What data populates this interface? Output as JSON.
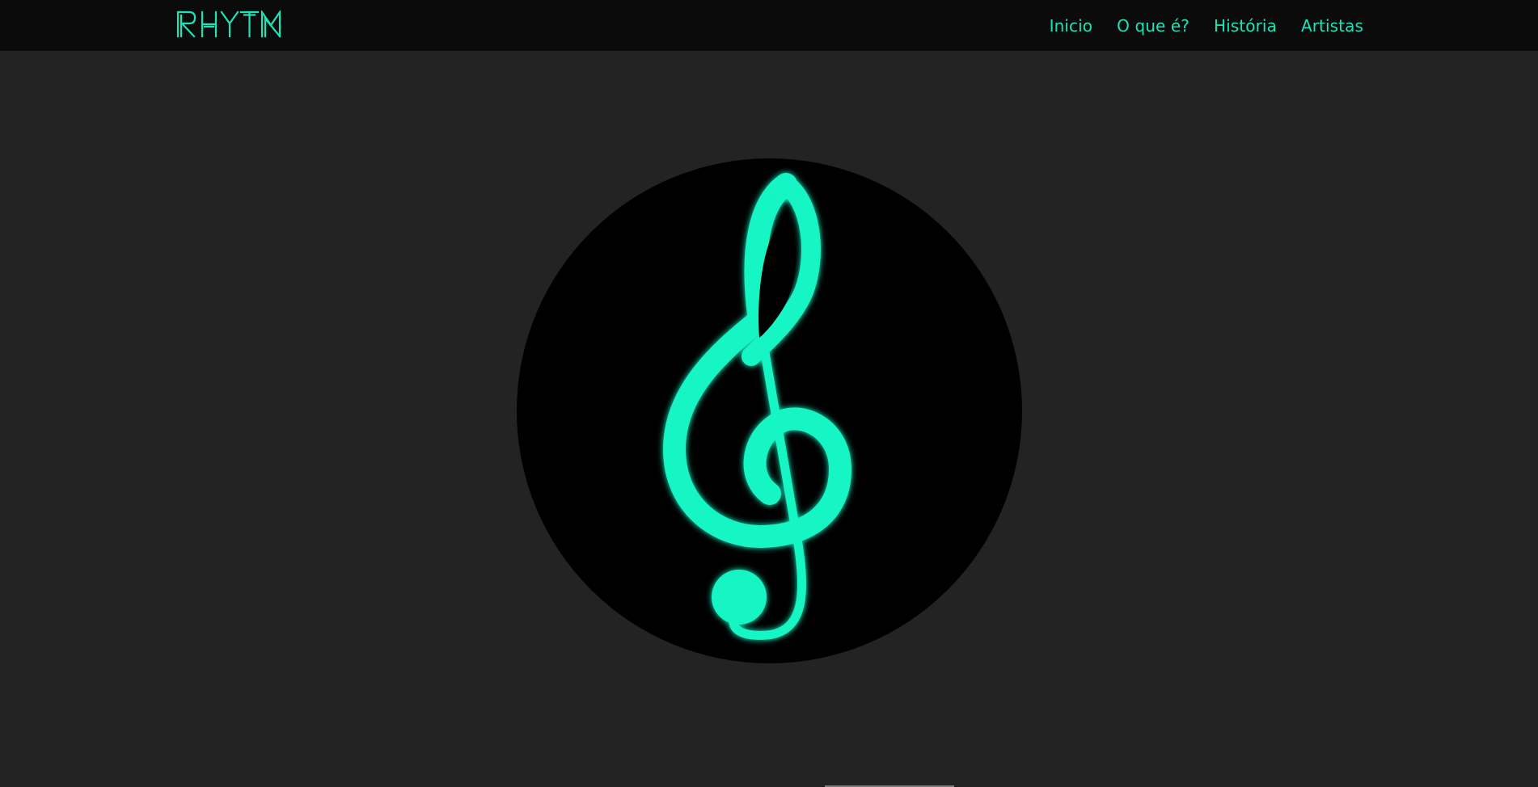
{
  "brand": {
    "name": "RHYTM",
    "accent_color": "#19e6b8"
  },
  "nav": {
    "items": [
      {
        "label": "Inicio"
      },
      {
        "label": "O que é?"
      },
      {
        "label": "História"
      },
      {
        "label": "Artistas"
      }
    ]
  },
  "hero": {
    "icon": "treble-clef-icon",
    "circle_color": "#000000",
    "icon_color": "#19f5c4"
  },
  "colors": {
    "navbar_bg": "#0b0b0b",
    "page_bg": "#232323"
  }
}
